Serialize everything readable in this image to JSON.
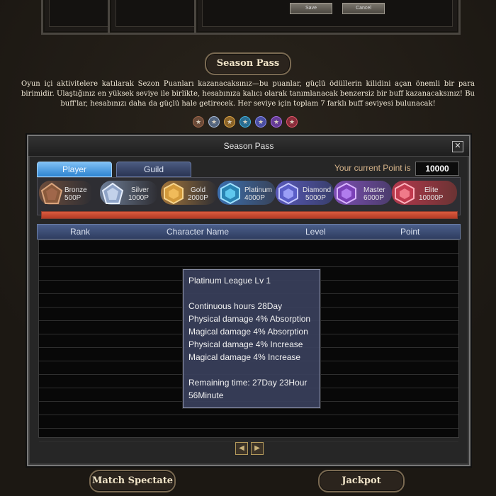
{
  "top_panels": {
    "save_label": "Save",
    "cancel_label": "Cancel"
  },
  "season_pass_button": "Season Pass",
  "description": "Oyun içi aktivitelere katılarak Sezon Puanları kazanacaksınız—bu puanlar, güçlü ödüllerin kilidini açan önemli bir para birimidir. Ulaştığınız en yüksek seviye ile birlikte, hesabınıza kalıcı olarak tanımlanacak benzersiz bir buff kazanacaksınız! Bu buff'lar, hesabınızı daha da güçlü hale getirecek. Her seviye için toplam 7 farklı buff seviyesi bulunacak!",
  "tier_icon_colors": [
    "#8a5a3c",
    "#8fa4c7",
    "#d39a3b",
    "#3fa7d6",
    "#7b7be0",
    "#9b63d6",
    "#d24c5f"
  ],
  "window": {
    "title": "Season Pass",
    "close_icon": "close-icon",
    "tabs": [
      {
        "label": "Player",
        "active": true
      },
      {
        "label": "Guild",
        "active": false
      }
    ],
    "current_point_label": "Your current Point is",
    "current_point_value": "10000",
    "tiers": [
      {
        "name": "Bronze",
        "points": "500P",
        "color": "#a0674a"
      },
      {
        "name": "Silver",
        "points": "1000P",
        "color": "#a9bcd9"
      },
      {
        "name": "Gold",
        "points": "2000P",
        "color": "#e0a645"
      },
      {
        "name": "Platinum",
        "points": "4000P",
        "color": "#44b3e0"
      },
      {
        "name": "Diamond",
        "points": "5000P",
        "color": "#8a8ef0"
      },
      {
        "name": "Master",
        "points": "6000P",
        "color": "#a86ce6"
      },
      {
        "name": "Elite",
        "points": "10000P",
        "color": "#e2586b"
      }
    ],
    "progress_fraction": 1.0,
    "table": {
      "headers": [
        "Rank",
        "Character Name",
        "Level",
        "Point"
      ],
      "rows": []
    },
    "pager": {
      "prev_icon": "triangle-left-icon",
      "next_icon": "triangle-right-icon"
    },
    "tooltip": {
      "title": "Platinum League Lv 1",
      "duration": "Continuous hours 28Day",
      "effects": [
        "Physical damage 4% Absorption",
        "Magical damage 4% Absorption",
        "Physical damage 4% Increase",
        "Magical damage 4% Increase"
      ],
      "remaining_1": "Remaining time: 27Day 23Hour",
      "remaining_2": "56Minute"
    }
  },
  "bottom_buttons": {
    "match_spectate": "Match Spectate",
    "jackpot": "Jackpot"
  }
}
